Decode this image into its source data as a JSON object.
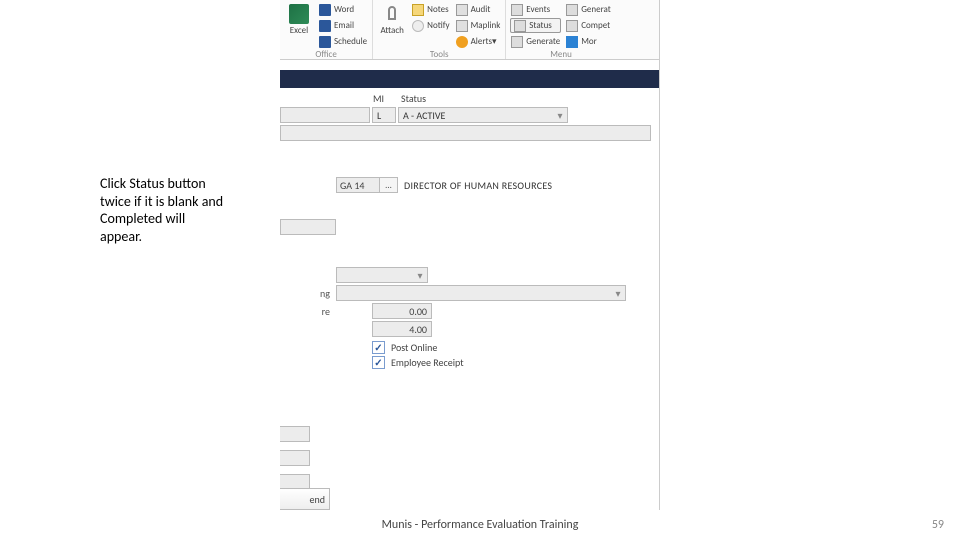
{
  "callout": "Click Status button twice if it is blank and Completed will appear.",
  "ribbon": {
    "office": {
      "label": "Office",
      "excel": "Excel",
      "word": "Word",
      "email": "Email",
      "schedule": "Schedule"
    },
    "tools": {
      "label": "Tools",
      "attach": "Attach",
      "notes": "Notes",
      "notify": "Notify",
      "audit": "Audit",
      "maplink": "Maplink",
      "alerts": "Alerts▾"
    },
    "menu": {
      "label": "Menu",
      "events": "Events",
      "status": "Status",
      "generate": "Generate",
      "generat": "Generat",
      "compet": "Compet",
      "more": "Mor"
    }
  },
  "form": {
    "mi_label": "MI",
    "status_label": "Status",
    "mi_value": "L",
    "status_value": "A - ACTIVE",
    "jobcode": "GA 14",
    "jobtitle": "DIRECTOR OF HUMAN RESOURCES",
    "trunc1": "ng",
    "trunc2": "re",
    "num1": "0.00",
    "num2": "4.00",
    "chk1": "Post Online",
    "chk2": "Employee Receipt",
    "end_button": "end"
  },
  "footer": {
    "title": "Munis - Performance Evaluation Training",
    "page": "59"
  }
}
